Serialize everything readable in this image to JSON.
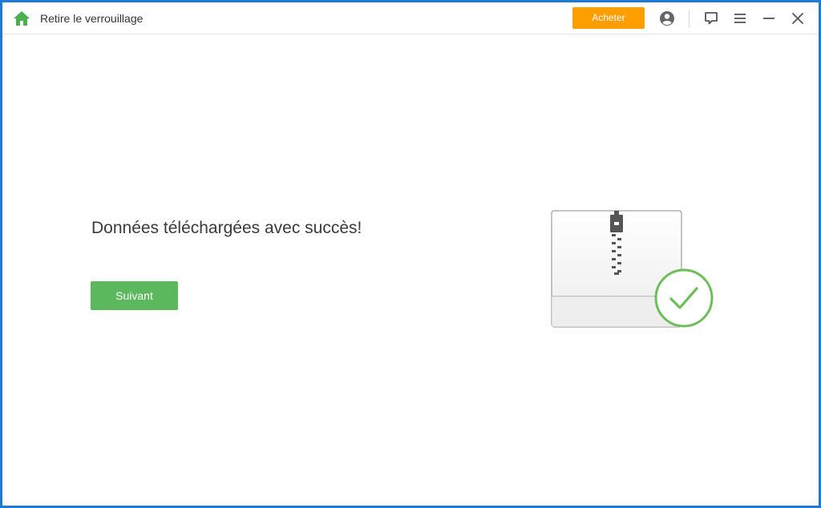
{
  "window": {
    "title": "Retire le verrouillage",
    "buy_label": "Acheter",
    "icons": {
      "home": "home-icon",
      "account": "account-icon",
      "feedback": "feedback-icon",
      "menu": "menu-icon",
      "minimize": "minimize-icon",
      "close": "close-icon"
    }
  },
  "main": {
    "message": "Données téléchargées avec succès!",
    "next_label": "Suivant",
    "illustration": {
      "archive": "zip-archive-icon",
      "status": "success-check-icon"
    }
  },
  "colors": {
    "window_border": "#1f7ad6",
    "buy_button": "#ff9e00",
    "next_button": "#5cb85c",
    "success_check": "#6bbf59",
    "home_icon": "#4caf50"
  }
}
